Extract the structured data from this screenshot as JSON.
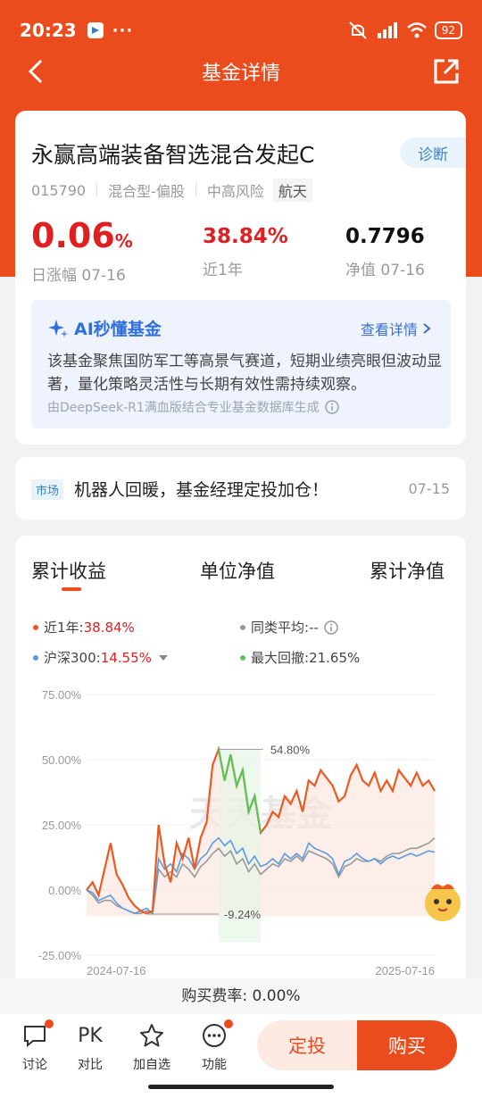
{
  "status": {
    "time": "20:23",
    "battery": "92",
    "dots": "···"
  },
  "nav": {
    "title": "基金详情"
  },
  "fund": {
    "name": "永赢高端装备智选混合发起C",
    "diagnose_label": "诊断",
    "code": "015790",
    "type": "混合型-偏股",
    "risk": "中高风险",
    "tag": "航天",
    "daily_change": "0.06",
    "daily_change_unit": "%",
    "daily_change_label": "日涨幅 07-16",
    "one_year_return": "38.84%",
    "one_year_label": "近1年",
    "nav_value": "0.7796",
    "nav_label": "净值 07-16"
  },
  "ai": {
    "title": "AI秒懂基金",
    "link": "查看详情",
    "text": "该基金聚焦国防军工等高景气赛道，短期业绩亮眼但波动显著，量化策略灵活性与长期有效性需持续观察。",
    "source": "由DeepSeek-R1满血版结合专业基金数据库生成"
  },
  "news": {
    "tag": "市场",
    "text": "机器人回暖，基金经理定投加仓！",
    "date": "07-15"
  },
  "chart_tabs": [
    "累计收益",
    "单位净值",
    "累计净值"
  ],
  "legend": {
    "fund_label": "近1年:",
    "fund_value": "38.84%",
    "peer_label": "同类平均:",
    "peer_value": "--",
    "index_label": "沪深300:",
    "index_value": "14.55%",
    "dd_label": "最大回撤:",
    "dd_value": "21.65%"
  },
  "colors": {
    "fund": "#ea5a22",
    "index": "#5b9be0",
    "peer": "#999999",
    "drawdown": "#5cc45c",
    "accent": "#ea4c1d"
  },
  "chart_data": {
    "type": "line",
    "ylim": [
      -25,
      75
    ],
    "yticks": [
      "75.00%",
      "50.00%",
      "25.00%",
      "0.00%",
      "-25.00%"
    ],
    "x_start": "2024-07-16",
    "x_end": "2025-07-16",
    "watermark": "天天基金",
    "annotations": [
      "54.80%",
      "-9.24%"
    ],
    "series": [
      {
        "name": "近1年",
        "values": [
          0,
          3,
          -2,
          8,
          18,
          6,
          2,
          -3,
          -6,
          -8,
          -9,
          -8,
          25,
          10,
          3,
          18,
          12,
          20,
          8,
          20,
          26,
          48,
          54,
          42,
          52,
          40,
          46,
          30,
          36,
          22,
          25,
          30,
          28,
          36,
          33,
          38,
          30,
          42,
          40,
          46,
          43,
          40,
          34,
          36,
          44,
          48,
          42,
          40,
          45,
          38,
          42,
          38,
          46,
          43,
          40,
          45,
          40,
          42,
          38
        ]
      },
      {
        "name": "沪深300",
        "values": [
          0,
          -1,
          -4,
          -3,
          -2,
          -5,
          -7,
          -8,
          -9,
          -8,
          -7,
          -9,
          12,
          8,
          10,
          7,
          14,
          12,
          8,
          12,
          14,
          18,
          20,
          17,
          19,
          14,
          16,
          10,
          13,
          9,
          10,
          12,
          10,
          14,
          12,
          14,
          12,
          18,
          16,
          15,
          14,
          12,
          6,
          11,
          12,
          14,
          12,
          11,
          12,
          10,
          12,
          13,
          12,
          13,
          14,
          13,
          14,
          15,
          14.5
        ]
      },
      {
        "name": "同类平均",
        "values": [
          0,
          -2,
          -5,
          -4,
          -4,
          -6,
          -7,
          -8,
          -9,
          -9,
          -8,
          -9,
          8,
          5,
          7,
          5,
          10,
          8,
          5,
          9,
          11,
          14,
          16,
          13,
          15,
          10,
          12,
          7,
          10,
          6,
          8,
          10,
          9,
          12,
          11,
          13,
          11,
          15,
          14,
          13,
          12,
          10,
          5,
          9,
          10,
          12,
          11,
          11,
          12,
          11,
          13,
          14,
          14,
          15,
          16,
          16,
          17,
          18,
          20
        ]
      }
    ]
  },
  "fee": {
    "label": "购买费率: 0.00%"
  },
  "bottom": {
    "discuss": "讨论",
    "pk": "PK",
    "compare": "对比",
    "watch": "加自选",
    "function": "功能",
    "dingtou": "定投",
    "buy": "购买"
  }
}
